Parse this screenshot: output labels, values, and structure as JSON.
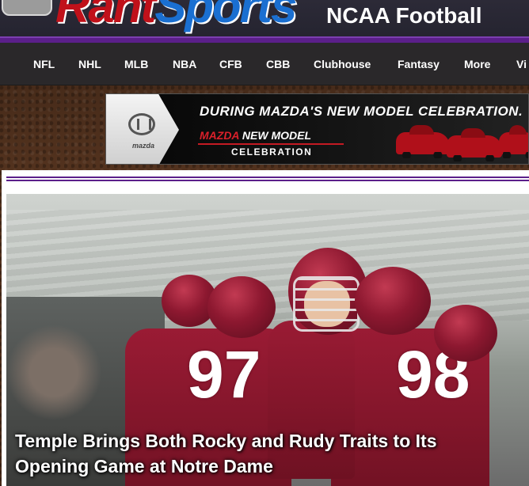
{
  "header": {
    "logo_part1": "Rant",
    "logo_part2": "Sports",
    "section_title": "NCAA Football"
  },
  "nav": {
    "items": [
      "NFL",
      "NHL",
      "MLB",
      "NBA",
      "CFB",
      "CBB",
      "Clubhouse",
      "Fantasy",
      "More",
      "Vi"
    ]
  },
  "ad": {
    "brand_small": "mazda",
    "headline": "DURING MAZDA'S NEW MODEL CELEBRATION.",
    "model_red": "MAZDA",
    "model_rest": " NEW MODEL",
    "celebration": "CELEBRATION"
  },
  "feature": {
    "caption": "Temple Brings Both Rocky and Rudy Traits to Its Opening Game at Notre Dame",
    "jersey_numbers": [
      "97",
      "98"
    ]
  },
  "colors": {
    "header_bg": "#2c2a37",
    "accent_purple": "#5b1f8a",
    "nav_bg": "#2a282a",
    "temple_cherry": "#9a1b34"
  }
}
